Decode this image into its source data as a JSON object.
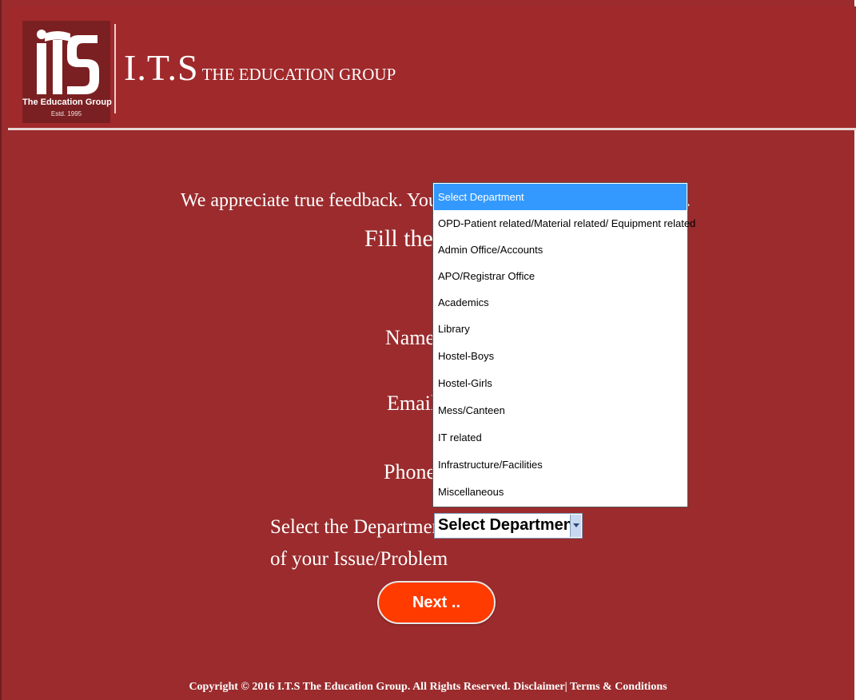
{
  "header": {
    "logo_tagline": "The Education Group",
    "logo_estd": "Estd. 1995",
    "brand_main": "I.T.S",
    "brand_sub": "THE EDUCATION GROUP"
  },
  "intro": {
    "text_visible": "We appreciate true feedback. Your",
    "text_tail": ".",
    "fill_visible": "Fill the"
  },
  "form": {
    "name_label": "Name",
    "email_label": "Email",
    "phone_label": "Phone",
    "department_label_line1": "Select the Department",
    "department_label_line2": "of your Issue/Problem",
    "department_selected": "Select Department",
    "department_options": [
      "Select Department",
      "OPD-Patient related/Material related/ Equipment related",
      "Admin Office/Accounts",
      "APO/Registrar Office",
      "Academics",
      "Library",
      "Hostel-Boys",
      "Hostel-Girls",
      "Mess/Canteen",
      "IT related",
      "Infrastructure/Facilities",
      "Miscellaneous"
    ],
    "next_label": "Next .."
  },
  "footer": {
    "copyright": "Copyright © 2016 I.T.S The Education Group. All Rights Reserved.",
    "disclaimer": "Disclaimer",
    "separator": "|",
    "terms": "Terms & Conditions"
  },
  "colors": {
    "background": "#9b2b2d",
    "dropdown_highlight": "#3399ff",
    "next_button": "#ff3b00"
  }
}
